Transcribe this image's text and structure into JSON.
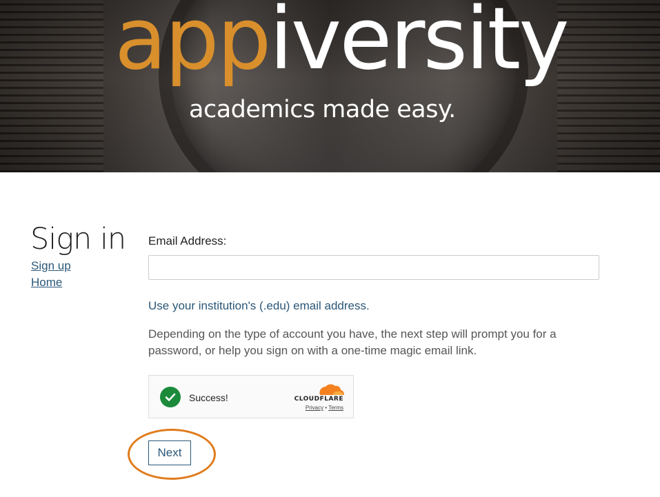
{
  "hero": {
    "logo_part1": "app",
    "logo_part2": "iversity",
    "tagline": "academics made easy."
  },
  "signin": {
    "title": "Sign in",
    "links": [
      "Sign up",
      "Home"
    ]
  },
  "form": {
    "email_label": "Email Address:",
    "email_value": "",
    "hint": "Use your institution's (.edu) email address.",
    "description": "Depending on the type of account you have, the next step will prompt you for a password, or help you sign on with a one-time magic email link.",
    "next_label": "Next"
  },
  "captcha": {
    "status": "Success!",
    "brand": "CLOUDFLARE",
    "privacy": "Privacy",
    "separator": "•",
    "terms": "Terms"
  },
  "colors": {
    "accent_orange": "#d88f2c",
    "link_blue": "#2b5778",
    "success_green": "#1b8a3b",
    "highlight_ring": "#e07b1c"
  }
}
